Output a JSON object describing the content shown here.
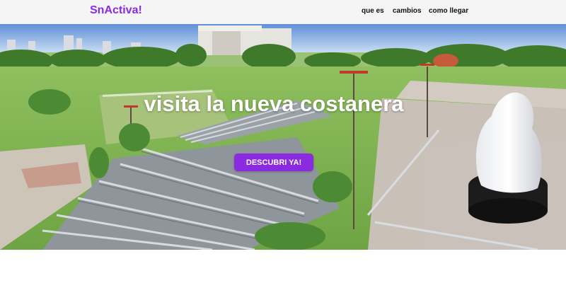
{
  "navbar": {
    "brand": "SnActiva!",
    "links": [
      "que es",
      "cambios",
      "como llegar"
    ]
  },
  "hero": {
    "title": "visita la nueva costanera",
    "cta_label": "DESCUBRI YA!",
    "image_alt": ""
  },
  "colors": {
    "brand": "#8a2be2",
    "cta_background": "#8a2be2",
    "navbar_background": "#f5f5f6"
  }
}
